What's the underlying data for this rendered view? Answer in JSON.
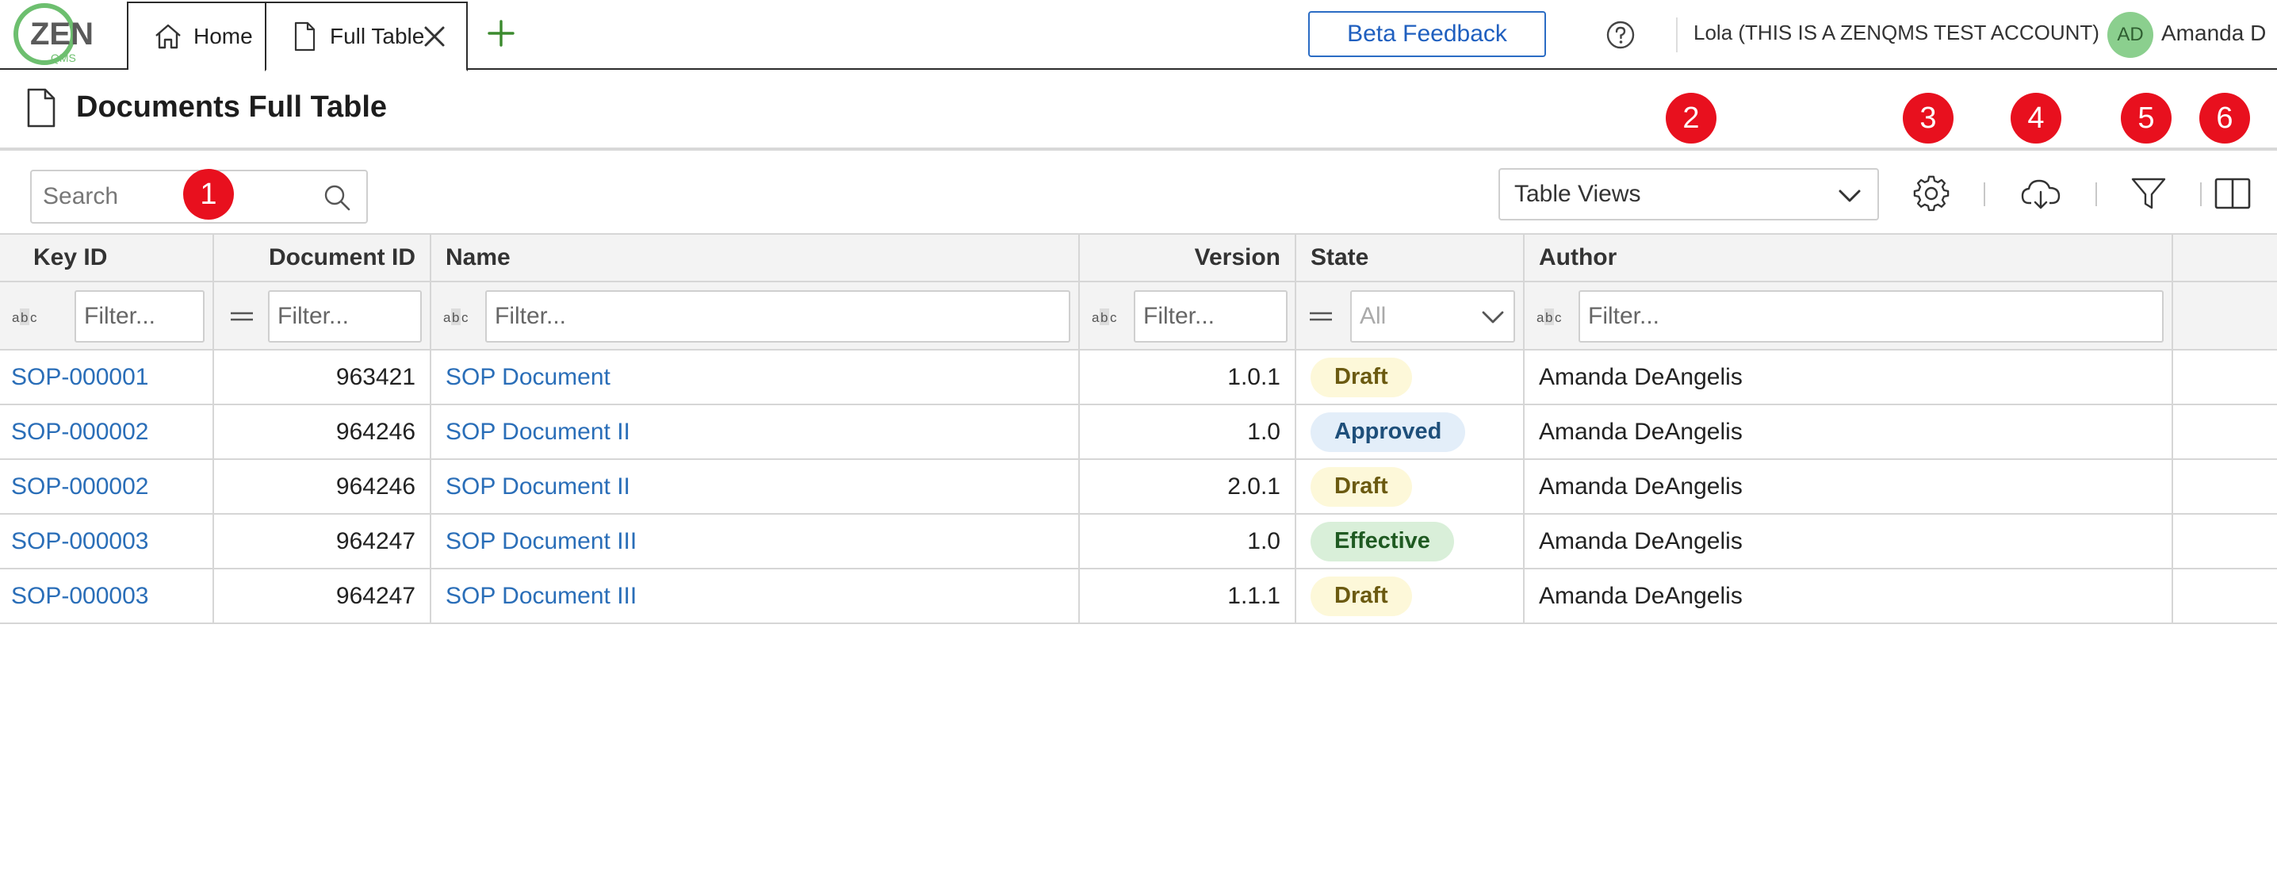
{
  "logo": {
    "text": "ZEN",
    "subtext": "QMS",
    "color": "#6dbf6f"
  },
  "tabs": [
    {
      "label": "Home",
      "icon": "home-icon"
    },
    {
      "label": "Full Table",
      "icon": "document-icon",
      "active": true
    }
  ],
  "header": {
    "beta_feedback": "Beta Feedback",
    "account": "Lola (THIS IS A ZENQMS TEST ACCOUNT)",
    "avatar_initials": "AD",
    "user_name": "Amanda D"
  },
  "page": {
    "title": "Documents Full Table"
  },
  "toolbar": {
    "search_placeholder": "Search",
    "table_views": "Table Views"
  },
  "badges": [
    "1",
    "2",
    "3",
    "4",
    "5",
    "6"
  ],
  "table": {
    "columns": [
      "Key ID",
      "Document ID",
      "Name",
      "Version",
      "State",
      "Author"
    ],
    "filter_placeholder": "Filter...",
    "state_filter_value": "All",
    "rows": [
      {
        "key_id": "SOP-000001",
        "document_id": "963421",
        "name": "SOP Document",
        "version": "1.0.1",
        "state": "Draft",
        "author": "Amanda DeAngelis"
      },
      {
        "key_id": "SOP-000002",
        "document_id": "964246",
        "name": "SOP Document II",
        "version": "1.0",
        "state": "Approved",
        "author": "Amanda DeAngelis"
      },
      {
        "key_id": "SOP-000002",
        "document_id": "964246",
        "name": "SOP Document II",
        "version": "2.0.1",
        "state": "Draft",
        "author": "Amanda DeAngelis"
      },
      {
        "key_id": "SOP-000003",
        "document_id": "964247",
        "name": "SOP Document III",
        "version": "1.0",
        "state": "Effective",
        "author": "Amanda DeAngelis"
      },
      {
        "key_id": "SOP-000003",
        "document_id": "964247",
        "name": "SOP Document III",
        "version": "1.1.1",
        "state": "Draft",
        "author": "Amanda DeAngelis"
      }
    ]
  },
  "state_colors": {
    "Draft": {
      "bg": "#fdf8d9",
      "fg": "#6b5a10"
    },
    "Approved": {
      "bg": "#e3eef9",
      "fg": "#1e4f7a"
    },
    "Effective": {
      "bg": "#d9efd9",
      "fg": "#1f5a22"
    }
  }
}
